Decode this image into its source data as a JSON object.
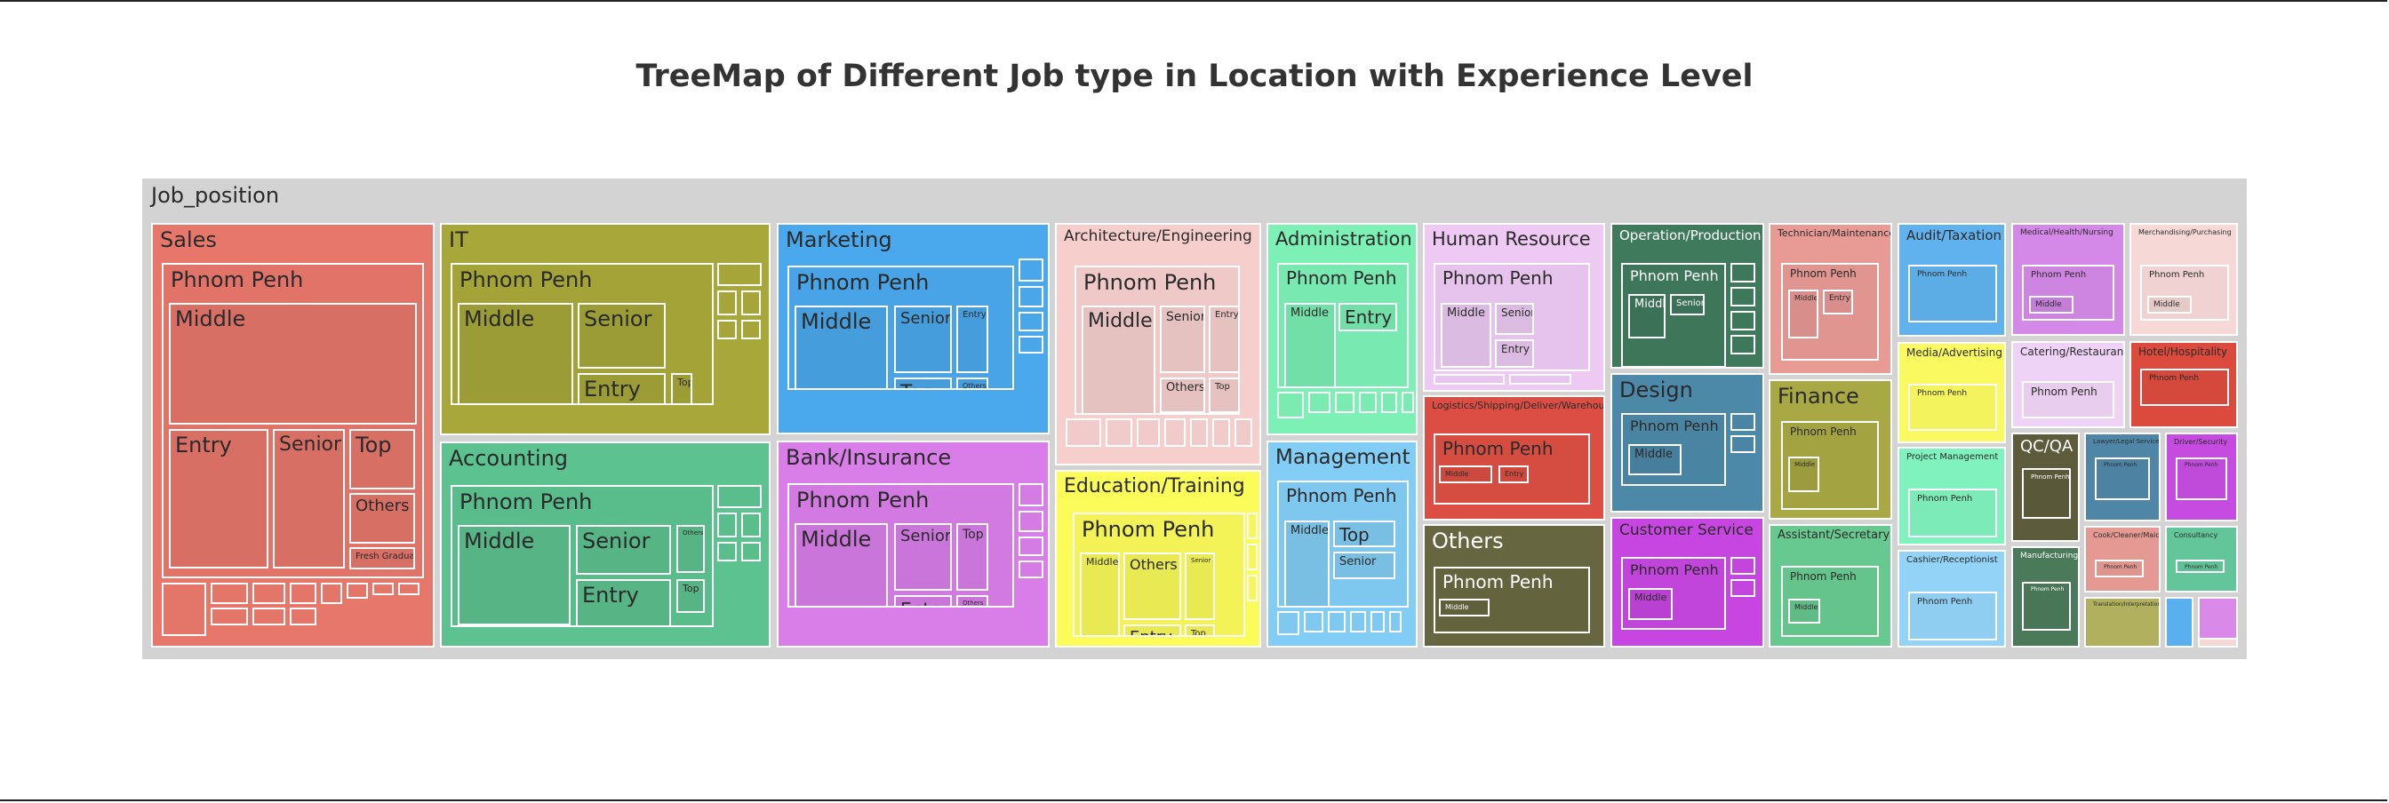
{
  "chart_data": {
    "type": "treemap",
    "title": "TreeMap of Different Job type in Location with Experience Level",
    "root": "Job_position",
    "colors": {
      "root": "#d3d3d3",
      "Sales": "#e8776b",
      "IT": "#a8a83a",
      "Accounting": "#5cc28f",
      "Marketing": "#4aa9ed",
      "Bank/Insurance": "#d97ee9",
      "Architecture/Engineering": "#f6cfcd",
      "Education/Training": "#fbfb5a",
      "Administration": "#7cf0b5",
      "Management": "#82cdf5",
      "Human Resource": "#edc9f3",
      "Logistics/Shipping/Deliver/Warehouse": "#dc4e43",
      "Others": "#666640",
      "Operation/Production": "#3f7a5c",
      "Design": "#4c88a8",
      "Customer Service": "#c746e2",
      "Technician/Maintenance": "#e89a95",
      "Finance": "#a8a844",
      "Assistant/Secretary": "#68c990",
      "Audit/Taxation": "#5fb2ed",
      "Media/Advertising": "#fafa60",
      "Project Management": "#80f2bd",
      "Cashier/Receptionist": "#93d3f8",
      "Medical/Health/Nursing": "#d488e8",
      "Catering/Restaurant": "#efd3f6",
      "Merchandising/Purchasing": "#f6d9d7",
      "Hotel/Hospitality": "#dc4a3e",
      "QC/QA": "#5c5c3c",
      "Manufacturing": "#4a7a5a",
      "Lawyer/Legal Service": "#4f86a8",
      "Driver/Security": "#c64ce1",
      "Cook/Cleaner/Maid": "#e49a92",
      "Consultancy": "#63c69a",
      "Translation/Interpretation": "#b0b05e",
      "Small category A": "#5ab0ee",
      "Small category B": "#d98ae8",
      "Small category C": "#f4d8d6"
    },
    "labels": {
      "root": "Job_position",
      "phnom_penh": "Phnom Penh",
      "middle": "Middle",
      "senior": "Senior",
      "entry": "Entry",
      "top": "Top",
      "others": "Others",
      "fresh_graduate": "Fresh Graduate"
    },
    "nodes": [
      {
        "name": "Sales",
        "color": "Sales",
        "children": [
          {
            "name": "Phnom Penh",
            "children": [
              {
                "name": "Middle"
              },
              {
                "name": "Entry"
              },
              {
                "name": "Senior"
              },
              {
                "name": "Top"
              },
              {
                "name": "Others"
              },
              {
                "name": "Fresh Graduate"
              }
            ]
          }
        ]
      },
      {
        "name": "IT",
        "color": "IT",
        "children": [
          {
            "name": "Phnom Penh",
            "children": [
              {
                "name": "Middle"
              },
              {
                "name": "Senior"
              },
              {
                "name": "Entry"
              },
              {
                "name": "Top"
              }
            ]
          }
        ]
      },
      {
        "name": "Accounting",
        "color": "Accounting",
        "children": [
          {
            "name": "Phnom Penh",
            "children": [
              {
                "name": "Middle"
              },
              {
                "name": "Senior"
              },
              {
                "name": "Entry"
              },
              {
                "name": "Top"
              },
              {
                "name": "Others"
              }
            ]
          }
        ]
      },
      {
        "name": "Marketing",
        "color": "Marketing",
        "children": [
          {
            "name": "Phnom Penh",
            "children": [
              {
                "name": "Middle"
              },
              {
                "name": "Senior"
              },
              {
                "name": "Entry"
              },
              {
                "name": "Top"
              },
              {
                "name": "Others"
              }
            ]
          }
        ]
      },
      {
        "name": "Bank/Insurance",
        "color": "Bank/Insurance",
        "children": [
          {
            "name": "Phnom Penh",
            "children": [
              {
                "name": "Middle"
              },
              {
                "name": "Senior"
              },
              {
                "name": "Top"
              },
              {
                "name": "Entry"
              },
              {
                "name": "Others"
              }
            ]
          }
        ]
      },
      {
        "name": "Architecture/Engineering",
        "color": "Architecture/Engineering",
        "children": [
          {
            "name": "Phnom Penh",
            "children": [
              {
                "name": "Middle"
              },
              {
                "name": "Senior"
              },
              {
                "name": "Entry"
              },
              {
                "name": "Others"
              },
              {
                "name": "Top"
              }
            ]
          }
        ]
      },
      {
        "name": "Education/Training",
        "color": "Education/Training",
        "children": [
          {
            "name": "Phnom Penh",
            "children": [
              {
                "name": "Middle"
              },
              {
                "name": "Others"
              },
              {
                "name": "Senior"
              },
              {
                "name": "Entry"
              },
              {
                "name": "Top"
              }
            ]
          }
        ]
      },
      {
        "name": "Administration",
        "color": "Administration",
        "children": [
          {
            "name": "Phnom Penh",
            "children": [
              {
                "name": "Middle"
              },
              {
                "name": "Entry"
              }
            ]
          }
        ]
      },
      {
        "name": "Management",
        "color": "Management",
        "children": [
          {
            "name": "Phnom Penh",
            "children": [
              {
                "name": "Middle"
              },
              {
                "name": "Top"
              },
              {
                "name": "Senior"
              }
            ]
          }
        ]
      },
      {
        "name": "Human Resource",
        "color": "Human Resource",
        "children": [
          {
            "name": "Phnom Penh",
            "children": [
              {
                "name": "Middle"
              },
              {
                "name": "Senior"
              },
              {
                "name": "Entry"
              }
            ]
          }
        ]
      },
      {
        "name": "Logistics/Shipping/Deliver/Warehouse",
        "color": "Logistics/Shipping/Deliver/Warehouse",
        "children": [
          {
            "name": "Phnom Penh",
            "children": [
              {
                "name": "Middle"
              },
              {
                "name": "Entry"
              }
            ]
          }
        ]
      },
      {
        "name": "Others",
        "color": "Others",
        "children": [
          {
            "name": "Phnom Penh",
            "children": [
              {
                "name": "Middle"
              }
            ]
          }
        ]
      },
      {
        "name": "Operation/Production",
        "color": "Operation/Production",
        "children": [
          {
            "name": "Phnom Penh",
            "children": [
              {
                "name": "Middle"
              },
              {
                "name": "Senior"
              }
            ]
          }
        ]
      },
      {
        "name": "Design",
        "color": "Design",
        "children": [
          {
            "name": "Phnom Penh",
            "children": [
              {
                "name": "Middle"
              }
            ]
          }
        ]
      },
      {
        "name": "Customer Service",
        "color": "Customer Service",
        "children": [
          {
            "name": "Phnom Penh",
            "children": [
              {
                "name": "Middle"
              }
            ]
          }
        ]
      },
      {
        "name": "Technician/Maintenance",
        "color": "Technician/Maintenance",
        "children": [
          {
            "name": "Phnom Penh",
            "children": [
              {
                "name": "Middle"
              },
              {
                "name": "Entry"
              }
            ]
          }
        ]
      },
      {
        "name": "Finance",
        "color": "Finance",
        "children": [
          {
            "name": "Phnom Penh",
            "children": [
              {
                "name": "Middle"
              }
            ]
          }
        ]
      },
      {
        "name": "Assistant/Secretary",
        "color": "Assistant/Secretary",
        "children": [
          {
            "name": "Phnom Penh",
            "children": [
              {
                "name": "Middle"
              }
            ]
          }
        ]
      },
      {
        "name": "Audit/Taxation",
        "color": "Audit/Taxation",
        "children": [
          {
            "name": "Phnom Penh"
          }
        ]
      },
      {
        "name": "Media/Advertising",
        "color": "Media/Advertising",
        "children": [
          {
            "name": "Phnom Penh"
          }
        ]
      },
      {
        "name": "Project Management",
        "color": "Project Management",
        "children": [
          {
            "name": "Phnom Penh"
          }
        ]
      },
      {
        "name": "Cashier/Receptionist",
        "color": "Cashier/Receptionist",
        "children": [
          {
            "name": "Phnom Penh"
          }
        ]
      },
      {
        "name": "Medical/Health/Nursing",
        "color": "Medical/Health/Nursing",
        "children": [
          {
            "name": "Phnom Penh",
            "children": [
              {
                "name": "Middle"
              }
            ]
          }
        ]
      },
      {
        "name": "Catering/Restaurant",
        "color": "Catering/Restaurant",
        "children": [
          {
            "name": "Phnom Penh"
          }
        ]
      },
      {
        "name": "Merchandising/Purchasing",
        "color": "Merchandising/Purchasing",
        "children": [
          {
            "name": "Phnom Penh",
            "children": [
              {
                "name": "Middle"
              }
            ]
          }
        ]
      },
      {
        "name": "Hotel/Hospitality",
        "color": "Hotel/Hospitality",
        "children": [
          {
            "name": "Phnom Penh"
          }
        ]
      },
      {
        "name": "QC/QA",
        "color": "QC/QA",
        "children": [
          {
            "name": "Phnom Penh"
          }
        ]
      },
      {
        "name": "Manufacturing",
        "color": "Manufacturing",
        "children": [
          {
            "name": "Phnom Penh"
          }
        ]
      },
      {
        "name": "Lawyer/Legal Service",
        "color": "Lawyer/Legal Service",
        "children": [
          {
            "name": "Phnom Penh"
          }
        ]
      },
      {
        "name": "Driver/Security",
        "color": "Driver/Security",
        "children": [
          {
            "name": "Phnom Penh"
          }
        ]
      },
      {
        "name": "Cook/Cleaner/Maid",
        "color": "Cook/Cleaner/Maid",
        "children": [
          {
            "name": "Phnom Penh"
          }
        ]
      },
      {
        "name": "Consultancy",
        "color": "Consultancy",
        "children": [
          {
            "name": "Phnom Penh"
          }
        ]
      },
      {
        "name": "Translation/Interpretation",
        "color": "Translation/Interpretation"
      }
    ]
  }
}
